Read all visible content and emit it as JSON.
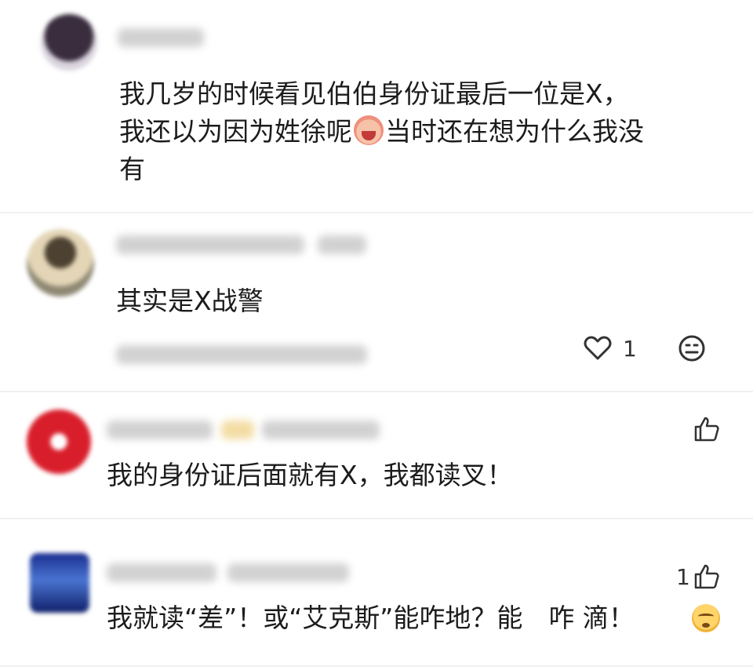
{
  "comments": [
    {
      "text_line1": "我几岁的时候看见伯伯身份证最后一位是X，",
      "text_line2a": "我还以为因为姓徐呢",
      "text_line2b": "当时还在想为什么我没",
      "text_line3": "有"
    },
    {
      "text": "其实是X战警",
      "like_count": "1"
    },
    {
      "text": "我的身份证后面就有X，我都读叉！"
    },
    {
      "text": "我就读“差”！或“艾克斯”能咋地？能　咋 滴！",
      "like_count": "1"
    }
  ],
  "icons": {
    "like": "heart-icon",
    "emoji": "emoji-icon",
    "thumb": "thumbs-up-icon"
  }
}
